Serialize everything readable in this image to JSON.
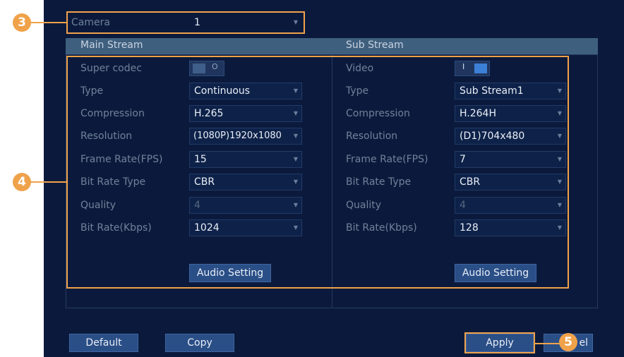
{
  "camera": {
    "label": "Camera",
    "value": "1"
  },
  "main_stream": {
    "title": "Main Stream",
    "super_codec": {
      "label": "Super codec",
      "state": "off"
    },
    "type": {
      "label": "Type",
      "value": "Continuous"
    },
    "compression": {
      "label": "Compression",
      "value": "H.265"
    },
    "resolution": {
      "label": "Resolution",
      "value": "(1080P)1920x1080"
    },
    "frame_rate": {
      "label": "Frame Rate(FPS)",
      "value": "15"
    },
    "bit_rate_type": {
      "label": "Bit Rate Type",
      "value": "CBR"
    },
    "quality": {
      "label": "Quality",
      "value": "4"
    },
    "bit_rate": {
      "label": "Bit Rate(Kbps)",
      "value": "1024"
    },
    "audio_button": "Audio Setting"
  },
  "sub_stream": {
    "title": "Sub Stream",
    "video": {
      "label": "Video",
      "state": "on"
    },
    "type": {
      "label": "Type",
      "value": "Sub Stream1"
    },
    "compression": {
      "label": "Compression",
      "value": "H.264H"
    },
    "resolution": {
      "label": "Resolution",
      "value": "(D1)704x480"
    },
    "frame_rate": {
      "label": "Frame Rate(FPS)",
      "value": "7"
    },
    "bit_rate_type": {
      "label": "Bit Rate Type",
      "value": "CBR"
    },
    "quality": {
      "label": "Quality",
      "value": "4"
    },
    "bit_rate": {
      "label": "Bit Rate(Kbps)",
      "value": "128"
    },
    "audio_button": "Audio Setting"
  },
  "footer": {
    "default_label": "Default",
    "copy_label": "Copy",
    "apply_label": "Apply",
    "cancel_partial_label": "el"
  },
  "callouts": {
    "c3": "3",
    "c4": "4",
    "c5": "5"
  },
  "colors": {
    "panel_bg": "#0b1a3c",
    "header_bar": "#3f5f7e",
    "callout_orange": "#f0a24a",
    "button_blue": "#2a4e86",
    "toggle_on": "#3c7fd6"
  },
  "icons": {
    "dropdown": "chevron-down-icon",
    "toggle_on_glyph": "I",
    "toggle_off_glyph": "O"
  }
}
